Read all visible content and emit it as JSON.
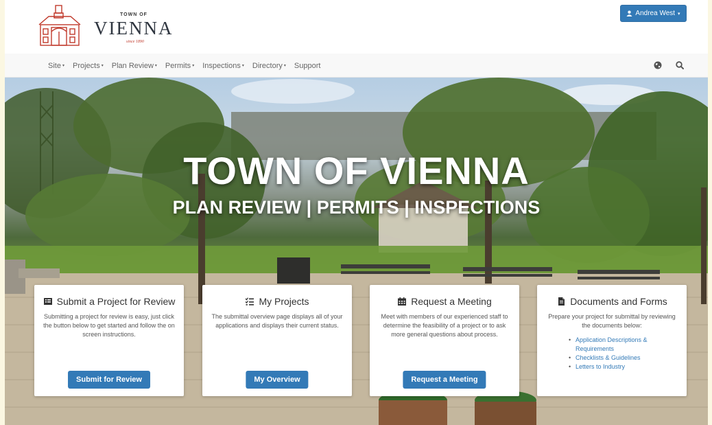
{
  "brand": {
    "town_of": "TOWN OF",
    "name": "VIENNA",
    "since": "since 1890"
  },
  "user_menu": {
    "label": "Andrea West"
  },
  "nav": {
    "items": [
      {
        "label": "Site",
        "dropdown": true
      },
      {
        "label": "Projects",
        "dropdown": true
      },
      {
        "label": "Plan Review",
        "dropdown": true
      },
      {
        "label": "Permits",
        "dropdown": true
      },
      {
        "label": "Inspections",
        "dropdown": true
      },
      {
        "label": "Directory",
        "dropdown": true
      },
      {
        "label": "Support",
        "dropdown": false
      }
    ],
    "icons": [
      "globe-icon",
      "search-icon"
    ]
  },
  "hero": {
    "title": "TOWN OF VIENNA",
    "subtitle": "PLAN REVIEW | PERMITS | INSPECTIONS"
  },
  "cards": [
    {
      "icon": "list-alt-icon",
      "title": "Submit a Project for Review",
      "description": "Submitting a project for review is easy, just click the button below to get started and follow the on screen instructions.",
      "button": "Submit for Review"
    },
    {
      "icon": "checklist-icon",
      "title": "My Projects",
      "description": "The submittal overview page displays all of your applications and displays their current status.",
      "button": "My Overview"
    },
    {
      "icon": "calendar-icon",
      "title": "Request a Meeting",
      "description": "Meet with members of our experienced staff to determine the feasibility of a project or to ask more general questions about process.",
      "button": "Request a Meeting"
    },
    {
      "icon": "document-icon",
      "title": "Documents and Forms",
      "description": "Prepare your project for submittal by reviewing the documents below:",
      "links": [
        "Application Descriptions & Requirements",
        "Checklists & Guidelines",
        "Letters to Industry"
      ]
    }
  ],
  "colors": {
    "primary": "#337ab7",
    "logo_red": "#c0392b",
    "page_margin": "#fbf7e2"
  }
}
